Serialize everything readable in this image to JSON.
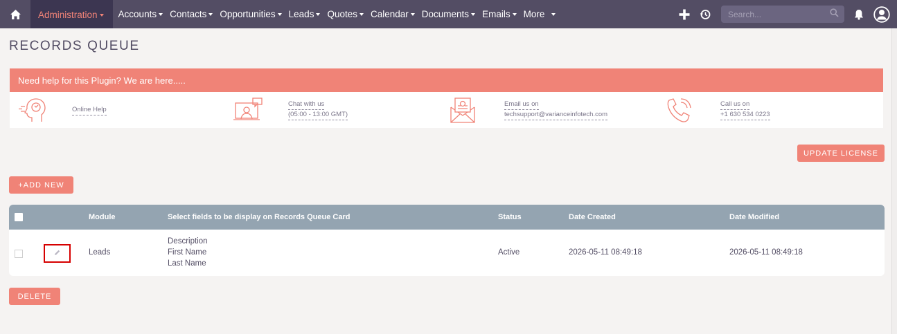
{
  "nav": {
    "items": [
      {
        "label": "Administration",
        "active": true
      },
      {
        "label": "Accounts"
      },
      {
        "label": "Contacts"
      },
      {
        "label": "Opportunities"
      },
      {
        "label": "Leads"
      },
      {
        "label": "Quotes"
      },
      {
        "label": "Calendar"
      },
      {
        "label": "Documents"
      },
      {
        "label": "Emails"
      },
      {
        "label": "More"
      }
    ],
    "search_placeholder": "Search...",
    "icons": [
      "home-icon",
      "plus-icon",
      "history-icon",
      "search-icon",
      "bell-icon",
      "user-icon"
    ]
  },
  "page": {
    "title": "RECORDS QUEUE"
  },
  "help": {
    "header": "Need help for this Plugin? We are here.....",
    "online_help": "Online Help",
    "chat_line1": "Chat with us",
    "chat_line2": "(05:00 - 13:00 GMT)",
    "email_line1": "Email us on",
    "email_line2": "techsupport@varianceinfotech.com",
    "call_line1": "Call us on",
    "call_line2": "+1 630 534 0223"
  },
  "buttons": {
    "update_license": "UPDATE LICENSE",
    "add_new": "+ADD NEW",
    "delete": "DELETE"
  },
  "table": {
    "headers": {
      "module": "Module",
      "fields": "Select fields to be display on Records Queue Card",
      "status": "Status",
      "date_created": "Date Created",
      "date_modified": "Date Modified"
    },
    "rows": [
      {
        "module": "Leads",
        "fields": [
          "Description",
          "First Name",
          "Last Name"
        ],
        "status": "Active",
        "date_created": "2026-05-11 08:49:18",
        "date_modified": "2026-05-11 08:49:18"
      }
    ]
  },
  "colors": {
    "navbar": "#534d64",
    "accent": "#f08377",
    "table_header": "#94a4b1",
    "highlight": "#d60000"
  }
}
